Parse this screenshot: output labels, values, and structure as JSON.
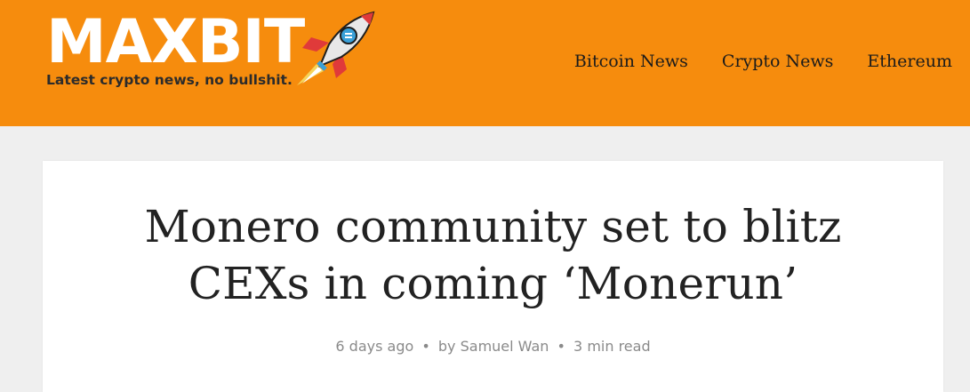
{
  "brand": {
    "name": "MAXBIT",
    "tagline": "Latest crypto news, no bullshit."
  },
  "nav": {
    "items": [
      "Bitcoin News",
      "Crypto News",
      "Ethereum"
    ]
  },
  "article": {
    "title_line1": "Monero community set to blitz",
    "title_line2": "CEXs in coming ‘Monerun’",
    "published": "6 days ago",
    "author_prefix": "by",
    "author": "Samuel Wan",
    "read_time": "3 min read",
    "separator": "•"
  },
  "colors": {
    "header_bg": "#f68c0d",
    "page_bg": "#efefef",
    "card_bg": "#ffffff",
    "title_text": "#222222",
    "meta_text": "#8a8a8a",
    "rocket_body": "#e8e8e8",
    "rocket_fins": "#e03a3a",
    "rocket_window": "#3aa0d8"
  },
  "icons": {
    "logo_mark": "rocket-icon"
  }
}
